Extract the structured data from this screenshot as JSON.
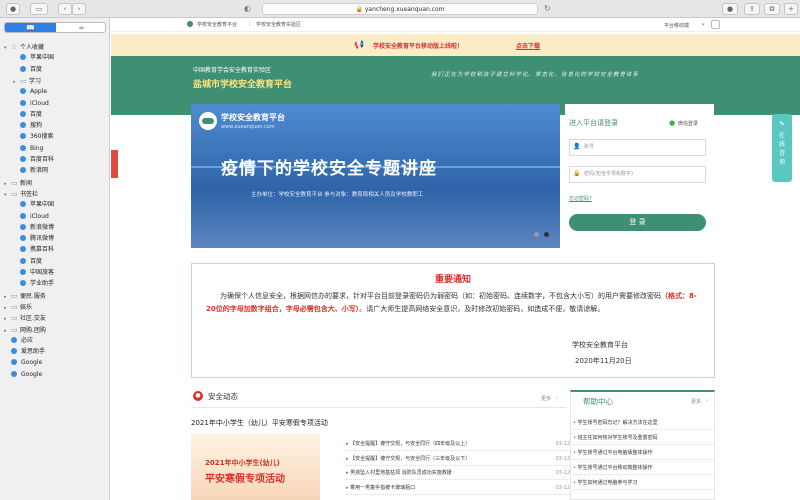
{
  "browser": {
    "url": "yancheng.xueanquan.com"
  },
  "sidebar": {
    "tab_bookmarks": "📖",
    "tab_reading": "∞",
    "items": [
      {
        "label": "个人收藏",
        "level": 0,
        "expand": "▾",
        "icon": "star-icon"
      },
      {
        "label": "苹果中国",
        "level": 1,
        "icon": "globe-icon"
      },
      {
        "label": "百度",
        "level": 1,
        "icon": "globe-icon"
      },
      {
        "label": "学习",
        "level": 1,
        "expand": "▸",
        "icon": "folder-icon"
      },
      {
        "label": "Apple",
        "level": 1,
        "icon": "globe-icon"
      },
      {
        "label": "iCloud",
        "level": 1,
        "icon": "globe-icon"
      },
      {
        "label": "百度",
        "level": 1,
        "icon": "globe-icon"
      },
      {
        "label": "搜狗",
        "level": 1,
        "icon": "globe-icon"
      },
      {
        "label": "360搜索",
        "level": 1,
        "icon": "globe-icon"
      },
      {
        "label": "Bing",
        "level": 1,
        "icon": "globe-icon"
      },
      {
        "label": "百度百科",
        "level": 1,
        "icon": "globe-icon"
      },
      {
        "label": "新浪网",
        "level": 1,
        "icon": "globe-icon"
      },
      {
        "label": "新闻",
        "level": 0,
        "expand": "▸",
        "icon": "folder-icon"
      },
      {
        "label": "书签栏",
        "level": 0,
        "expand": "▾",
        "icon": "folder-icon"
      },
      {
        "label": "苹果中国",
        "level": 1,
        "icon": "globe-icon"
      },
      {
        "label": "iCloud",
        "level": 1,
        "icon": "globe-icon"
      },
      {
        "label": "新浪微博",
        "level": 1,
        "icon": "globe-icon"
      },
      {
        "label": "腾讯微博",
        "level": 1,
        "icon": "globe-icon"
      },
      {
        "label": "携慕百科",
        "level": 1,
        "icon": "globe-icon"
      },
      {
        "label": "百度",
        "level": 1,
        "icon": "globe-icon"
      },
      {
        "label": "中国旅客",
        "level": 1,
        "icon": "globe-icon"
      },
      {
        "label": "学业助手",
        "level": 1,
        "icon": "globe-icon"
      },
      {
        "label": "便民.服务",
        "level": 0,
        "expand": "▸",
        "icon": "folder-icon"
      },
      {
        "label": "娱乐",
        "level": 0,
        "expand": "▸",
        "icon": "folder-icon"
      },
      {
        "label": "社区.交友",
        "level": 0,
        "expand": "▸",
        "icon": "folder-icon"
      },
      {
        "label": "网购.团购",
        "level": 0,
        "expand": "▸",
        "icon": "folder-icon"
      },
      {
        "label": "必应",
        "level": 0,
        "icon": "globe-icon"
      },
      {
        "label": "爱思助手",
        "level": 0,
        "icon": "globe-icon"
      },
      {
        "label": "Google",
        "level": 0,
        "icon": "globe-icon"
      },
      {
        "label": "Google",
        "level": 0,
        "icon": "globe-icon"
      }
    ]
  },
  "page": {
    "topnav": {
      "left1": "学校安全教育平台",
      "sep": "|",
      "left2": "学校安全教育实验区",
      "right": "平台移动端"
    },
    "banner": {
      "text": "学校安全教育平台移动版上线啦！",
      "link": "点击下载"
    },
    "header": {
      "small_title": "中国教育学会安全教育实验区",
      "big_title": "盐城市学校安全教育平台",
      "slogan": "我们正在为学校和孩子建立科学化、常态化、信息化的学校安全教育体系"
    },
    "carousel": {
      "logo_title": "学校安全教育平台",
      "logo_url": "www.xueanquan.com",
      "headline": "疫情下的学校安全专题讲座",
      "sub": "主办单位：学校安全教育平台      参与对象：教育局相关人员及学校教职工"
    },
    "login": {
      "title": "进入平台请登录",
      "wechat": "微信登录",
      "account_placeholder": "账号",
      "password_placeholder": "密码(包含字母和数字)",
      "forgot": "忘记密码?",
      "button": "登 录"
    },
    "side_float": {
      "label": "在线咨询"
    },
    "notice": {
      "title": "重要通知",
      "p1": "为确保个人信息安全，根据网信办的要求，针对平台目前登录密码仍为弱密码（如：初始密码、连续数字，不包含大小写）的用户需要修改密码",
      "highlight": "（格式：8-20位的字母加数字组合，字母必需包含大、小写）",
      "p2": "。请广大师生提高网络安全意识，及时修改初始密码，如造成不便，敬请谅解。",
      "sign": "学校安全教育平台",
      "date": "2020年11月20日"
    },
    "news": {
      "title": "安全动态",
      "more": "更多",
      "headline": "2021年中小学生（幼儿）平安寒假专项活动",
      "thumb_line1": "2021年中小学生(幼儿)",
      "thumb_line2": "平安寒假专项活动",
      "items": [
        {
          "text": "【安全提醒】遵守交规，与安全同行（四年级及以上）",
          "date": "03-12"
        },
        {
          "text": "【安全提醒】遵守交规，与安全同行（三年级及以下）",
          "date": "03-12"
        },
        {
          "text": "男孩坠入村里地基枯洞 消防队员成功实施救援",
          "date": "03-12"
        },
        {
          "text": "乘用一男童手指被卡玻璃瓶口",
          "date": "03-12"
        }
      ]
    },
    "help": {
      "title": "帮助中心",
      "more": "更多",
      "items": [
        "学生账号密码忘记？解决方法在这里",
        "班主任如何核对学生账号及重置密码",
        "学生账号通过平台电脑版整体操作",
        "学生账号通过平台移动端整体操作",
        "学生如何通过电脑参与学习"
      ]
    }
  },
  "colors": {
    "header_green": "#3e8f74",
    "accent_red": "#d9322b",
    "sidebar_blue": "#2f7fe6"
  }
}
